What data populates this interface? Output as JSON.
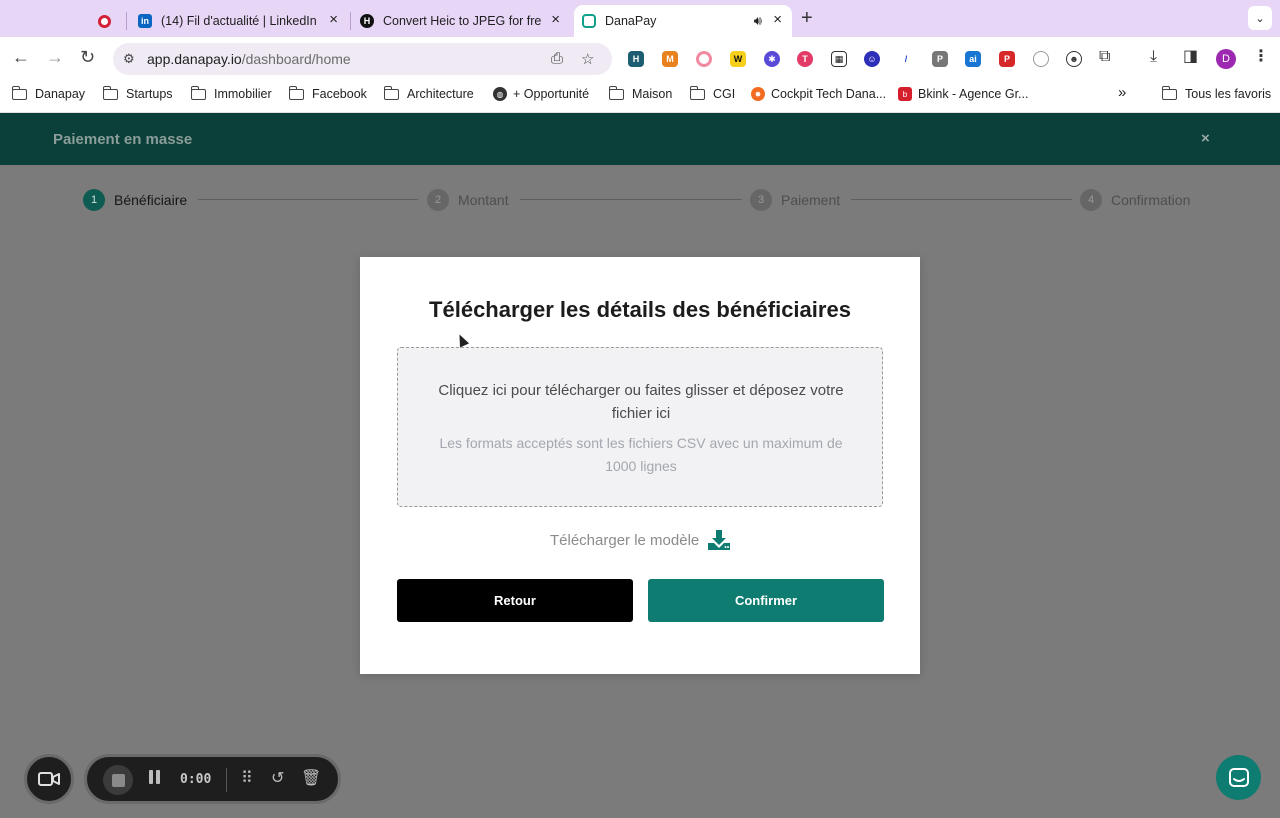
{
  "browser": {
    "tabs": [
      {
        "title": "",
        "favicon": "record-icon"
      },
      {
        "title": "(14) Fil d'actualité | LinkedIn",
        "favicon": "linkedin-icon"
      },
      {
        "title": "Convert Heic to JPEG for free",
        "favicon": "heic-icon"
      },
      {
        "title": "DanaPay",
        "favicon": "danapay-icon",
        "active": true
      }
    ],
    "url_host": "app.danapay.io",
    "url_path": "/dashboard/home",
    "avatar_letter": "D",
    "bookmarks": [
      {
        "label": "Danapay",
        "icon": "folder-icon"
      },
      {
        "label": "Startups",
        "icon": "folder-icon"
      },
      {
        "label": "Immobilier",
        "icon": "folder-icon"
      },
      {
        "label": "Facebook",
        "icon": "folder-icon"
      },
      {
        "label": "Architecture",
        "icon": "folder-icon"
      },
      {
        "label": "+ Opportunité",
        "icon": "globe-icon"
      },
      {
        "label": "Maison",
        "icon": "folder-icon"
      },
      {
        "label": "CGI",
        "icon": "folder-icon"
      },
      {
        "label": "Cockpit Tech Dana...",
        "icon": "cockpit-icon"
      },
      {
        "label": "Bkink - Agence Gr...",
        "icon": "bkink-icon"
      }
    ],
    "bookmarks_more": "»",
    "all_bookmarks": "Tous les favoris"
  },
  "app": {
    "header_title": "Paiement en masse",
    "close_symbol": "×",
    "steps": [
      {
        "num": "1",
        "label": "Bénéficiaire",
        "active": true
      },
      {
        "num": "2",
        "label": "Montant",
        "active": false
      },
      {
        "num": "3",
        "label": "Paiement",
        "active": false
      },
      {
        "num": "4",
        "label": "Confirmation",
        "active": false
      }
    ],
    "accent_color": "#0e7c70",
    "header_color": "#0b3f39"
  },
  "modal": {
    "title": "Télécharger les détails des bénéficiaires",
    "dropzone_main": "Cliquez ici pour télécharger ou faites glisser et déposez votre fichier ici",
    "dropzone_sub": "Les formats acceptés sont les fichiers CSV avec un maximum de 1000 lignes",
    "template_link": "Télécharger le modèle",
    "back_button": "Retour",
    "confirm_button": "Confirmer"
  },
  "recorder": {
    "time": "0:00"
  }
}
